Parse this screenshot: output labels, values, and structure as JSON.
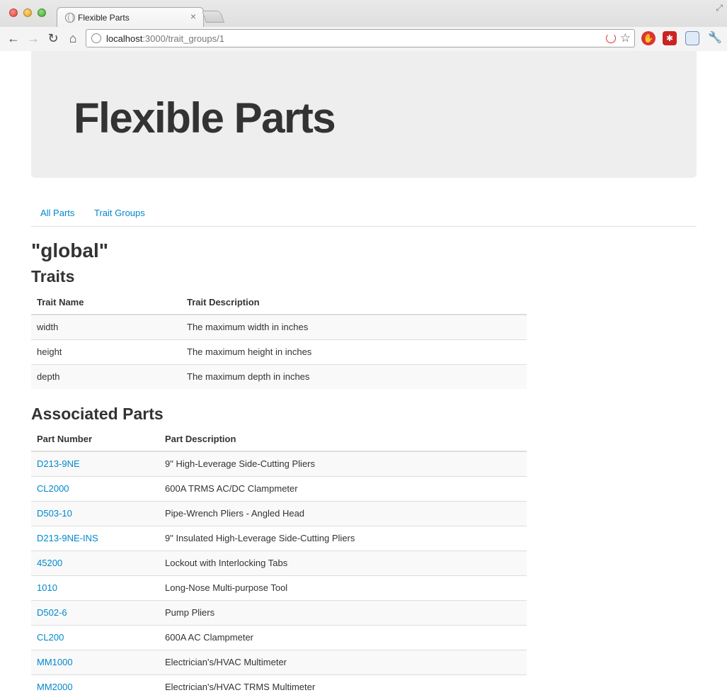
{
  "browser": {
    "tab_title": "Flexible Parts",
    "tab_close": "×",
    "url_host": "localhost",
    "url_rest": ":3000/trait_groups/1"
  },
  "hero": {
    "title": "Flexible Parts"
  },
  "nav": {
    "all_parts": "All Parts",
    "trait_groups": "Trait Groups"
  },
  "group": {
    "name": "\"global\""
  },
  "traits": {
    "heading": "Traits",
    "columns": [
      "Trait Name",
      "Trait Description"
    ],
    "rows": [
      {
        "name": "width",
        "description": "The maximum width in inches"
      },
      {
        "name": "height",
        "description": "The maximum height in inches"
      },
      {
        "name": "depth",
        "description": "The maximum depth in inches"
      }
    ]
  },
  "parts": {
    "heading": "Associated Parts",
    "columns": [
      "Part Number",
      "Part Description"
    ],
    "rows": [
      {
        "number": "D213-9NE",
        "description": "9\" High-Leverage Side-Cutting Pliers"
      },
      {
        "number": "CL2000",
        "description": "600A TRMS AC/DC Clampmeter"
      },
      {
        "number": "D503-10",
        "description": "Pipe-Wrench Pliers - Angled Head"
      },
      {
        "number": "D213-9NE-INS",
        "description": "9\" Insulated High-Leverage Side-Cutting Pliers"
      },
      {
        "number": "45200",
        "description": "Lockout with Interlocking Tabs"
      },
      {
        "number": "1010",
        "description": "Long-Nose Multi-purpose Tool"
      },
      {
        "number": "D502-6",
        "description": "Pump Pliers"
      },
      {
        "number": "CL200",
        "description": "600A AC Clampmeter"
      },
      {
        "number": "MM1000",
        "description": "Electrician's/HVAC Multimeter"
      },
      {
        "number": "MM2000",
        "description": "Electrician's/HVAC TRMS Multimeter"
      }
    ]
  },
  "colors": {
    "link": "#0088cc",
    "hero_bg": "#eeeeee",
    "stripe": "#f9f9f9"
  }
}
